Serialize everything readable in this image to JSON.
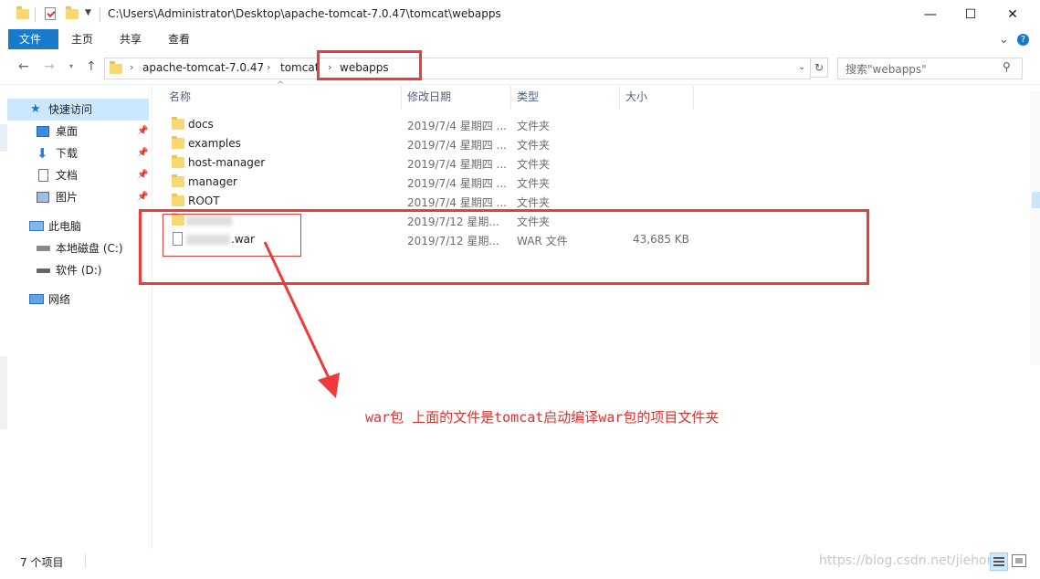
{
  "window": {
    "title": "C:\\Users\\Administrator\\Desktop\\apache-tomcat-7.0.47\\tomcat\\webapps",
    "minimize": "—",
    "maximize": "☐",
    "close": "✕"
  },
  "ribbon": {
    "tabs": [
      "文件",
      "主页",
      "共享",
      "查看"
    ],
    "expand": "⌄",
    "help": "?"
  },
  "address": {
    "crumbs": [
      "apache-tomcat-7.0.47",
      "tomcat",
      "webapps"
    ],
    "search_placeholder": "搜索\"webapps\""
  },
  "nav": {
    "quick_access": "快速访问",
    "desktop": "桌面",
    "downloads": "下载",
    "documents": "文档",
    "pictures": "图片",
    "this_pc": "此电脑",
    "local_disk": "本地磁盘 (C:)",
    "soft_disk": "软件 (D:)",
    "network": "网络"
  },
  "columns": {
    "name": "名称",
    "modified": "修改日期",
    "type": "类型",
    "size": "大小"
  },
  "files": [
    {
      "name": "docs",
      "date": "2019/7/4 星期四 ...",
      "type": "文件夹",
      "size": ""
    },
    {
      "name": "examples",
      "date": "2019/7/4 星期四 ...",
      "type": "文件夹",
      "size": ""
    },
    {
      "name": "host-manager",
      "date": "2019/7/4 星期四 ...",
      "type": "文件夹",
      "size": ""
    },
    {
      "name": "manager",
      "date": "2019/7/4 星期四 ...",
      "type": "文件夹",
      "size": ""
    },
    {
      "name": "ROOT",
      "date": "2019/7/4 星期四 ...",
      "type": "文件夹",
      "size": ""
    },
    {
      "name": "",
      "date": "2019/7/12 星期...",
      "type": "文件夹",
      "size": ""
    },
    {
      "name": ".war",
      "date": "2019/7/12 星期...",
      "type": "WAR 文件",
      "size": "43,685 KB"
    }
  ],
  "status": {
    "count": "7 个项目"
  },
  "annotation": "war包 上面的文件是tomcat启动编译war包的项目文件夹",
  "watermark": "https://blog.csdn.net/jiehong",
  "colors": {
    "accent": "#1979ca",
    "annotation_red": "#ef3a3a",
    "selection": "#cce8ff"
  }
}
